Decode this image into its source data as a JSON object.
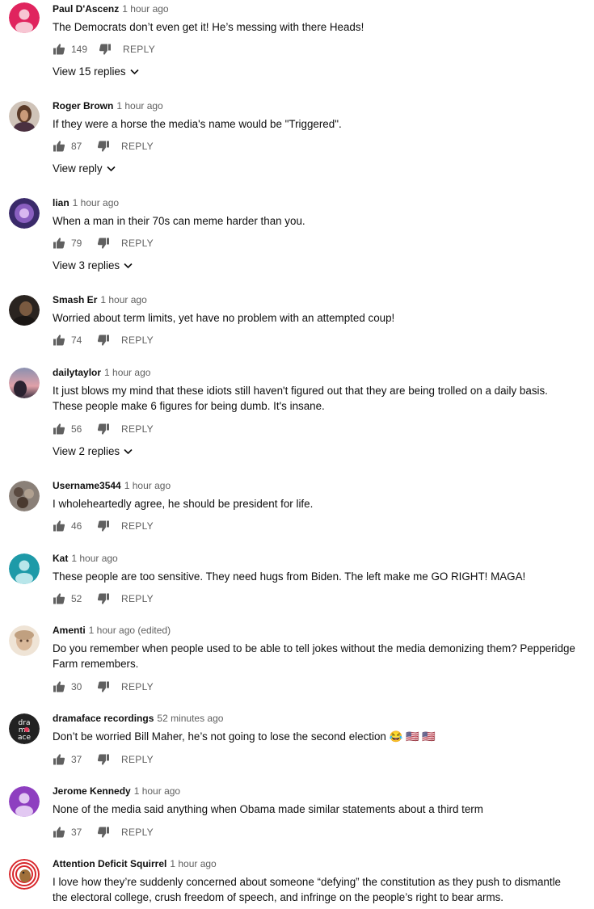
{
  "reply_label": "REPLY",
  "comments": [
    {
      "author": "Paul D'Ascenz",
      "time": "1 hour ago",
      "text": "The Democrats don’t even get it! He’s messing with there Heads!",
      "likes": "149",
      "view_replies": "View 15 replies",
      "avatar_color": "#e0245e"
    },
    {
      "author": "Roger Brown",
      "time": "1 hour ago",
      "text": "If they were a horse the media's name would be \"Triggered\".",
      "likes": "87",
      "view_replies": "View reply",
      "avatar_color": "#6b4a3a"
    },
    {
      "author": "lian",
      "time": "1 hour ago",
      "text": "When a man in their 70s can meme harder than you.",
      "likes": "79",
      "view_replies": "View 3 replies",
      "avatar_color": "#5b3f8f"
    },
    {
      "author": "Smash Er",
      "time": "1 hour ago",
      "text": "Worried about term limits, yet have no problem with an attempted coup!",
      "likes": "74",
      "view_replies": "",
      "avatar_color": "#3a3028"
    },
    {
      "author": "dailytaylor",
      "time": "1 hour ago",
      "text": "It just blows my mind that these idiots still haven't figured out that they are being trolled on a daily basis. These people make 6 figures for being dumb. It's insane.",
      "likes": "56",
      "view_replies": "View 2 replies",
      "avatar_color": "#7a6a70"
    },
    {
      "author": "Username3544",
      "time": "1 hour ago",
      "text": "I wholeheartedly agree, he should be president for life.",
      "likes": "46",
      "view_replies": "",
      "avatar_color": "#6a6058"
    },
    {
      "author": "Kat",
      "time": "1 hour ago",
      "text": "These people are too sensitive. They need hugs from Biden. The left make me GO RIGHT! MAGA!",
      "likes": "52",
      "view_replies": "",
      "avatar_color": "#1e9aa8"
    },
    {
      "author": "Amenti",
      "time": "1 hour ago (edited)",
      "text": "Do you remember when people used to be able to tell jokes without the media demonizing them? Pepperidge Farm remembers.",
      "likes": "30",
      "view_replies": "",
      "avatar_color": "#d9c2a8"
    },
    {
      "author": "dramaface recordings",
      "time": "52 minutes ago",
      "text": "Don’t be worried Bill Maher, he’s not going to lose the second election 😂 🇺🇸 🇺🇸",
      "likes": "37",
      "view_replies": "",
      "avatar_color": "#222222"
    },
    {
      "author": "Jerome Kennedy",
      "time": "1 hour ago",
      "text": "None of the media said anything when Obama made similar statements about a third term",
      "likes": "37",
      "view_replies": "",
      "avatar_color": "#8e3fc0"
    },
    {
      "author": "Attention Deficit Squirrel",
      "time": "1 hour ago",
      "text": "I love how they’re suddenly concerned about someone “defying” the constitution as they push to dismantle the electoral college, crush freedom of speech, and infringe on the people’s right to bear arms.",
      "likes": "",
      "view_replies": "",
      "avatar_color": "#d8262b"
    }
  ]
}
